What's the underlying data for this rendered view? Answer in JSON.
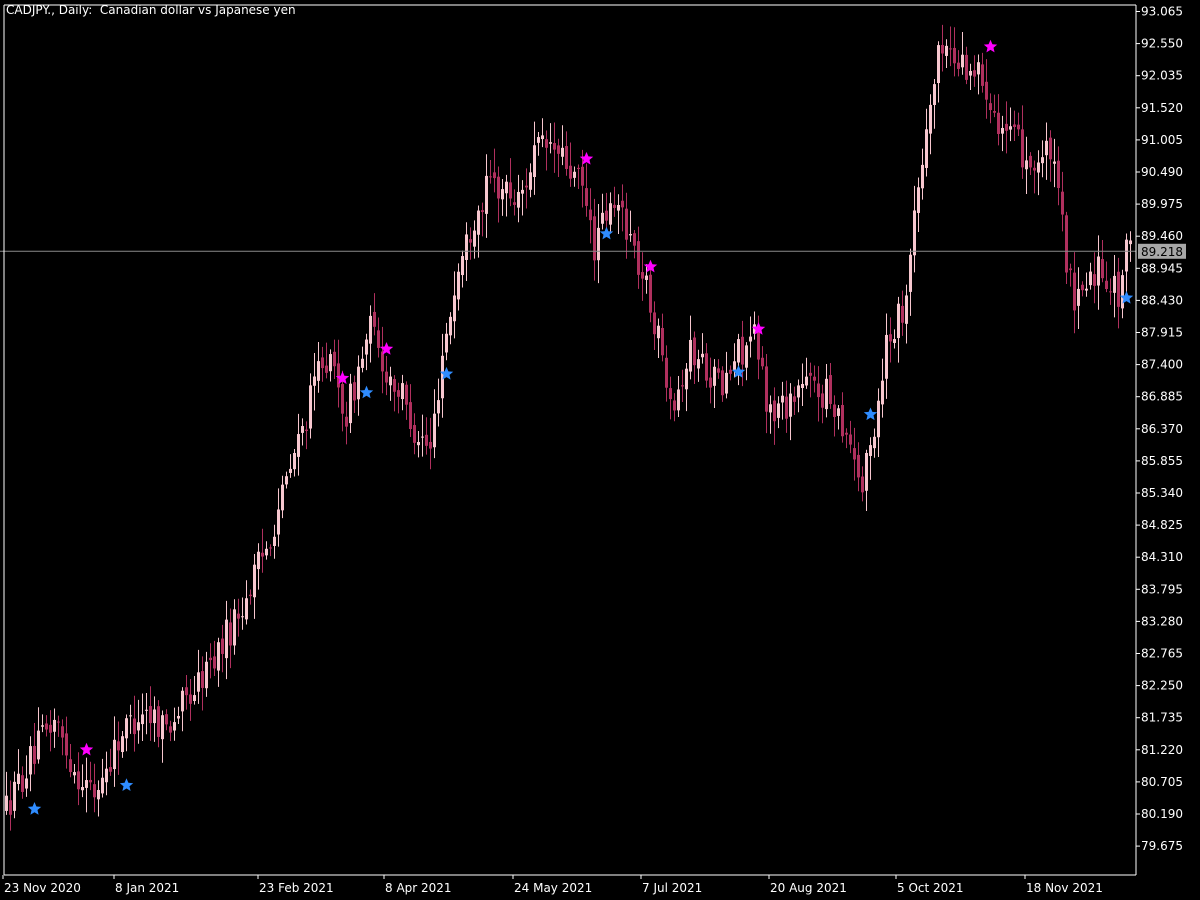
{
  "header": {
    "symbol": "CADJPY.",
    "timeframe": "Daily:",
    "description": "Canadian dollar vs Japanese yen"
  },
  "colors": {
    "background": "#000000",
    "axis": "#ffffff",
    "bull": "#f7c7cf",
    "bear": "#b0305e",
    "current_price_line": "#8a8a8a",
    "current_price_tag_bg": "#a7a7a7",
    "star_high": "#ff00ff",
    "star_low": "#2f8cff"
  },
  "chart_data": {
    "type": "candlestick",
    "y_ticks": [
      "93.065",
      "92.550",
      "92.035",
      "91.520",
      "91.005",
      "90.490",
      "89.975",
      "89.460",
      "88.945",
      "88.430",
      "87.915",
      "87.400",
      "86.885",
      "86.370",
      "85.855",
      "85.340",
      "84.825",
      "84.310",
      "83.795",
      "83.280",
      "82.765",
      "82.250",
      "81.735",
      "81.220",
      "80.705",
      "80.190",
      "79.675"
    ],
    "ylim": [
      79.09,
      93.13
    ],
    "x_ticks": [
      "23 Nov 2020",
      "8 Jan 2021",
      "23 Feb 2021",
      "8 Apr 2021",
      "24 May 2021",
      "7 Jul 2021",
      "20 Aug 2021",
      "5 Oct 2021",
      "18 Nov 2021"
    ],
    "current_price": "89.218",
    "trend_path": [
      [
        0,
        80.3
      ],
      [
        4,
        80.8
      ],
      [
        9,
        81.4
      ],
      [
        12,
        81.7
      ],
      [
        17,
        80.9
      ],
      [
        22,
        80.5
      ],
      [
        28,
        81.4
      ],
      [
        34,
        81.9
      ],
      [
        40,
        81.6
      ],
      [
        46,
        82.1
      ],
      [
        52,
        82.7
      ],
      [
        58,
        83.4
      ],
      [
        64,
        84.3
      ],
      [
        70,
        85.5
      ],
      [
        76,
        86.8
      ],
      [
        79,
        87.6
      ],
      [
        82,
        87.2
      ],
      [
        85,
        86.6
      ],
      [
        88,
        87.3
      ],
      [
        91,
        88.0
      ],
      [
        94,
        87.4
      ],
      [
        98,
        87.0
      ],
      [
        102,
        86.4
      ],
      [
        106,
        86.0
      ],
      [
        109,
        87.6
      ],
      [
        113,
        88.9
      ],
      [
        117,
        89.8
      ],
      [
        121,
        90.3
      ],
      [
        125,
        90.2
      ],
      [
        128,
        90.0
      ],
      [
        132,
        90.8
      ],
      [
        136,
        90.9
      ],
      [
        140,
        90.6
      ],
      [
        144,
        90.2
      ],
      [
        147,
        89.3
      ],
      [
        150,
        89.8
      ],
      [
        154,
        89.9
      ],
      [
        158,
        89.0
      ],
      [
        161,
        88.4
      ],
      [
        164,
        87.5
      ],
      [
        167,
        86.9
      ],
      [
        171,
        87.6
      ],
      [
        175,
        87.4
      ],
      [
        179,
        87.0
      ],
      [
        183,
        87.6
      ],
      [
        187,
        87.8
      ],
      [
        191,
        86.6
      ],
      [
        195,
        86.8
      ],
      [
        199,
        87.1
      ],
      [
        203,
        87.0
      ],
      [
        207,
        86.8
      ],
      [
        211,
        86.2
      ],
      [
        214,
        85.4
      ],
      [
        217,
        86.4
      ],
      [
        220,
        87.8
      ],
      [
        224,
        88.3
      ],
      [
        228,
        90.2
      ],
      [
        231,
        91.6
      ],
      [
        234,
        92.6
      ],
      [
        237,
        92.3
      ],
      [
        241,
        92.2
      ],
      [
        245,
        91.9
      ],
      [
        249,
        91.2
      ],
      [
        253,
        90.9
      ],
      [
        257,
        90.6
      ],
      [
        261,
        90.8
      ],
      [
        264,
        89.6
      ],
      [
        267,
        88.2
      ],
      [
        270,
        88.8
      ],
      [
        274,
        89.0
      ],
      [
        278,
        88.5
      ],
      [
        280,
        89.2
      ]
    ],
    "stars_high": [
      {
        "i": 20,
        "price": 81.22
      },
      {
        "i": 84,
        "price": 87.18
      },
      {
        "i": 95,
        "price": 87.65
      },
      {
        "i": 145,
        "price": 90.7
      },
      {
        "i": 161,
        "price": 88.97
      },
      {
        "i": 188,
        "price": 87.97
      },
      {
        "i": 246,
        "price": 92.5
      }
    ],
    "stars_low": [
      {
        "i": 7,
        "price": 80.27
      },
      {
        "i": 30,
        "price": 80.65
      },
      {
        "i": 90,
        "price": 86.95
      },
      {
        "i": 110,
        "price": 87.25
      },
      {
        "i": 150,
        "price": 89.5
      },
      {
        "i": 183,
        "price": 87.28
      },
      {
        "i": 216,
        "price": 86.6
      },
      {
        "i": 280,
        "price": 88.47
      }
    ]
  }
}
